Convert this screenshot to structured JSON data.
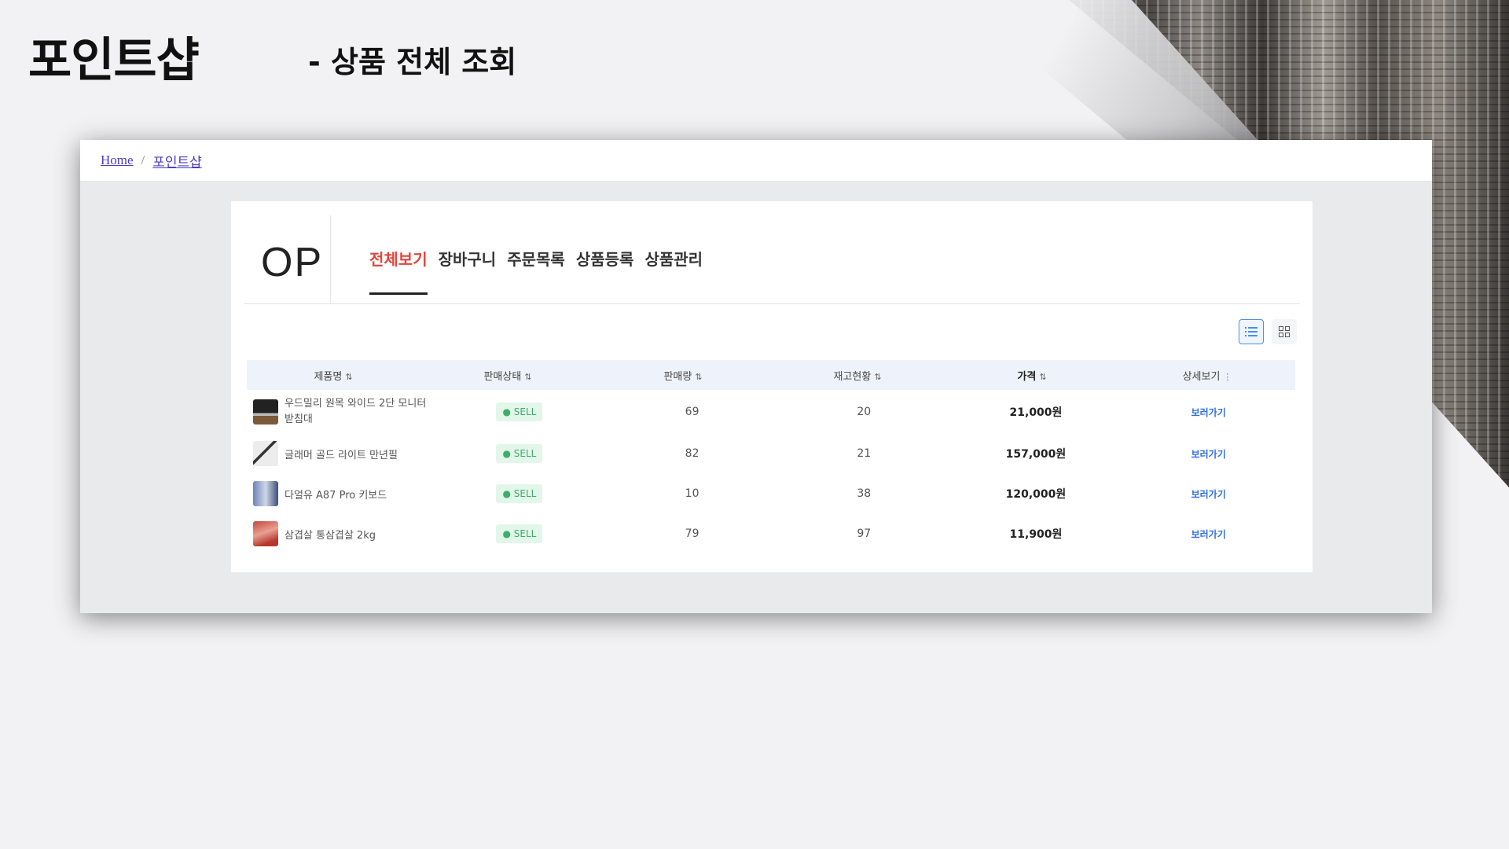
{
  "slide": {
    "title": "포인트샵",
    "subtitle": "- 상품 전체 조회"
  },
  "breadcrumb": {
    "home": "Home",
    "separator": "/",
    "current": "포인트샵"
  },
  "shop": {
    "logo": "OP",
    "tabs": [
      "전체보기",
      "장바구니",
      "주문목록",
      "상품등록",
      "상품관리"
    ],
    "active_tab": "전체보기",
    "view_toggle": {
      "list_icon": "list-view-icon",
      "grid_icon": "grid-view-icon",
      "active": "list"
    }
  },
  "table": {
    "headers": [
      "제품명",
      "판매상태",
      "판매량",
      "재고현황",
      "가격",
      "상세보기"
    ],
    "rows": [
      {
        "name": "우드밀리 원목 와이드 2단 모니터받침대",
        "status": "● SELL",
        "sold": "69",
        "stock": "20",
        "price": "21,000원",
        "detail": "보러가기"
      },
      {
        "name": "글래머 골드 라이트 만년필",
        "status": "● SELL",
        "sold": "82",
        "stock": "21",
        "price": "157,000원",
        "detail": "보러가기"
      },
      {
        "name": "다얼유 A87 Pro 키보드",
        "status": "● SELL",
        "sold": "10",
        "stock": "38",
        "price": "120,000원",
        "detail": "보러가기"
      },
      {
        "name": "삼겹살 통삼겹살 2kg",
        "status": "● SELL",
        "sold": "79",
        "stock": "97",
        "price": "11,900원",
        "detail": "보러가기"
      }
    ]
  },
  "colors": {
    "accent": "#e2453c",
    "link": "#2f6fe0",
    "sell_bg": "#e3f6ea",
    "sell_text": "#3cae6a",
    "table_head": "#eef3fb"
  }
}
